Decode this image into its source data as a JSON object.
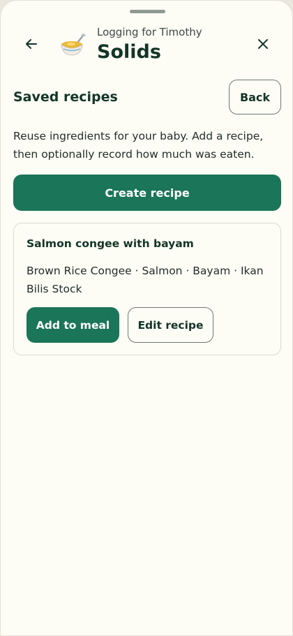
{
  "header": {
    "subtitle": "Logging for Timothy",
    "title": "Solids",
    "back_icon": "arrow-left-icon",
    "close_icon": "close-icon",
    "category_icon": "bowl-icon"
  },
  "section": {
    "title": "Saved recipes",
    "back_label": "Back",
    "description": "Reuse ingredients for your baby. Add a recipe, then optionally record how much was eaten.",
    "create_label": "Create recipe"
  },
  "recipes": [
    {
      "name": "Salmon congee with bayam",
      "ingredients": "Brown Rice Congee · Salmon · Bayam · Ikan Bilis Stock",
      "add_label": "Add to meal",
      "edit_label": "Edit recipe"
    }
  ],
  "colors": {
    "primary": "#1b7558",
    "background": "#fdfcf5",
    "heading": "#133528"
  }
}
